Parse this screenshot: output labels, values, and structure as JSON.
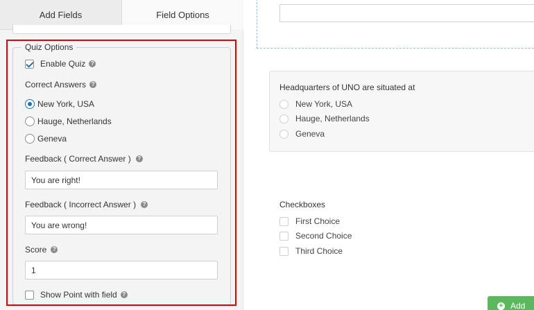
{
  "tabs": [
    {
      "label": "Add Fields"
    },
    {
      "label": "Field Options"
    }
  ],
  "quiz_options": {
    "legend": "Quiz Options",
    "enable_quiz": {
      "label": "Enable Quiz",
      "checked": true
    },
    "correct_answers_label": "Correct Answers",
    "answers": [
      {
        "label": "New York, USA",
        "selected": true
      },
      {
        "label": "Hauge, Netherlands",
        "selected": false
      },
      {
        "label": "Geneva",
        "selected": false
      }
    ],
    "feedback_correct": {
      "label": "Feedback ( Correct Answer )",
      "value": "You are right!"
    },
    "feedback_incorrect": {
      "label": "Feedback ( Incorrect Answer )",
      "value": "You are wrong!"
    },
    "score": {
      "label": "Score",
      "value": "1"
    },
    "show_point": {
      "label": "Show Point with field",
      "checked": false
    },
    "help_glyph": "?"
  },
  "preview": {
    "question": {
      "title": "Headquarters of UNO are situated at",
      "options": [
        "New York, USA",
        "Hauge, Netherlands",
        "Geneva"
      ]
    },
    "checkboxes": {
      "title": "Checkboxes",
      "options": [
        "First Choice",
        "Second Choice",
        "Third Choice"
      ]
    },
    "add_button": {
      "label": "Add"
    }
  },
  "colors": {
    "highlight": "#e10000",
    "accent": "#2271b1",
    "add_button": "#5cb85c"
  }
}
